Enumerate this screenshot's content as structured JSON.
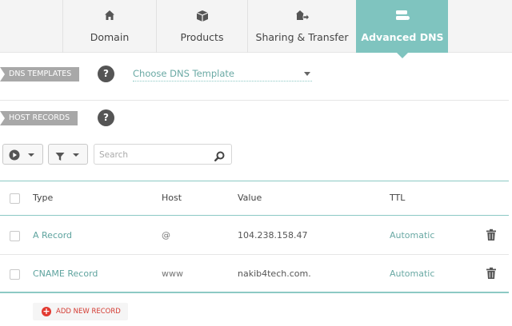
{
  "tabs": [
    {
      "label": "Domain",
      "icon": "house-icon"
    },
    {
      "label": "Products",
      "icon": "box-icon"
    },
    {
      "label": "Sharing & Transfer",
      "icon": "transfer-icon"
    },
    {
      "label": "Advanced DNS",
      "icon": "server-icon",
      "active": true
    }
  ],
  "dns_templates": {
    "label": "DNS TEMPLATES",
    "help": "?",
    "select_value": "Choose DNS Template"
  },
  "host_records": {
    "label": "HOST RECORDS",
    "help": "?"
  },
  "toolbar": {
    "search_placeholder": "Search"
  },
  "table": {
    "columns": [
      "Type",
      "Host",
      "Value",
      "TTL"
    ],
    "rows": [
      {
        "type": "A Record",
        "host": "@",
        "value": "104.238.158.47",
        "ttl": "Automatic"
      },
      {
        "type": "CNAME Record",
        "host": "www",
        "value": "nakib4tech.com.",
        "ttl": "Automatic"
      }
    ]
  },
  "add_record_label": "ADD NEW RECORD",
  "colors": {
    "accent": "#7fc4bf",
    "danger": "#e23a31"
  }
}
